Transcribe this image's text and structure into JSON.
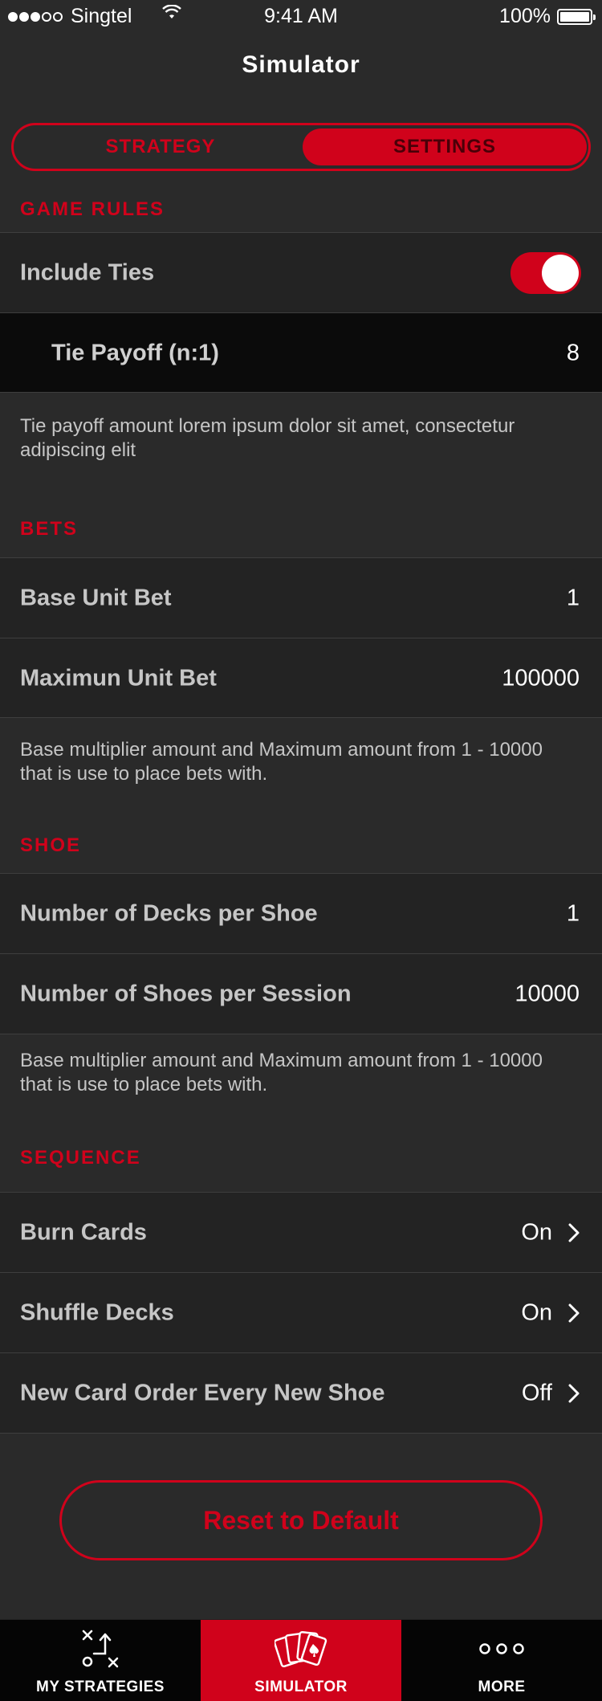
{
  "status_bar": {
    "carrier": "Singtel",
    "time": "9:41 AM",
    "battery": "100%"
  },
  "nav": {
    "title": "Simulator"
  },
  "segments": {
    "strategy": "STRATEGY",
    "settings": "SETTINGS",
    "selected": "settings"
  },
  "sections": {
    "game_rules": {
      "header": "GAME  RULES",
      "include_ties": {
        "label": "Include Ties",
        "enabled": true
      },
      "tie_payoff": {
        "label": "Tie Payoff (n:1)",
        "value": "8"
      },
      "note": "Tie payoff amount lorem ipsum dolor sit amet, consectetur adipiscing elit"
    },
    "bets": {
      "header": "BETS",
      "base_unit_bet": {
        "label": "Base Unit Bet",
        "value": "1"
      },
      "max_unit_bet": {
        "label": "Maximun Unit Bet",
        "value": "100000"
      },
      "note": "Base multiplier amount and Maximum amount from 1 - 10000 that is use to place bets with."
    },
    "shoe": {
      "header": "SHOE",
      "decks_per_shoe": {
        "label": "Number of Decks per Shoe",
        "value": "1"
      },
      "shoes_per_session": {
        "label": "Number of Shoes per Session",
        "value": "10000"
      },
      "note": "Base multiplier amount and Maximum amount from 1 - 10000 that is use to place bets with."
    },
    "sequence": {
      "header": "SEQUENCE",
      "burn_cards": {
        "label": "Burn Cards",
        "value": "On"
      },
      "shuffle_decks": {
        "label": "Shuffle Decks",
        "value": "On"
      },
      "new_card_order": {
        "label": "New Card Order Every New Shoe",
        "value": "Off"
      }
    }
  },
  "reset_button": {
    "label": "Reset to Default"
  },
  "tab_bar": {
    "my_strategies": "MY STRATEGIES",
    "simulator": "SIMULATOR",
    "more": "MORE",
    "selected": "simulator"
  },
  "colors": {
    "accent": "#d0021b",
    "background": "#2a2a2a",
    "row": "#232323",
    "sub_row": "#0b0b0b"
  }
}
